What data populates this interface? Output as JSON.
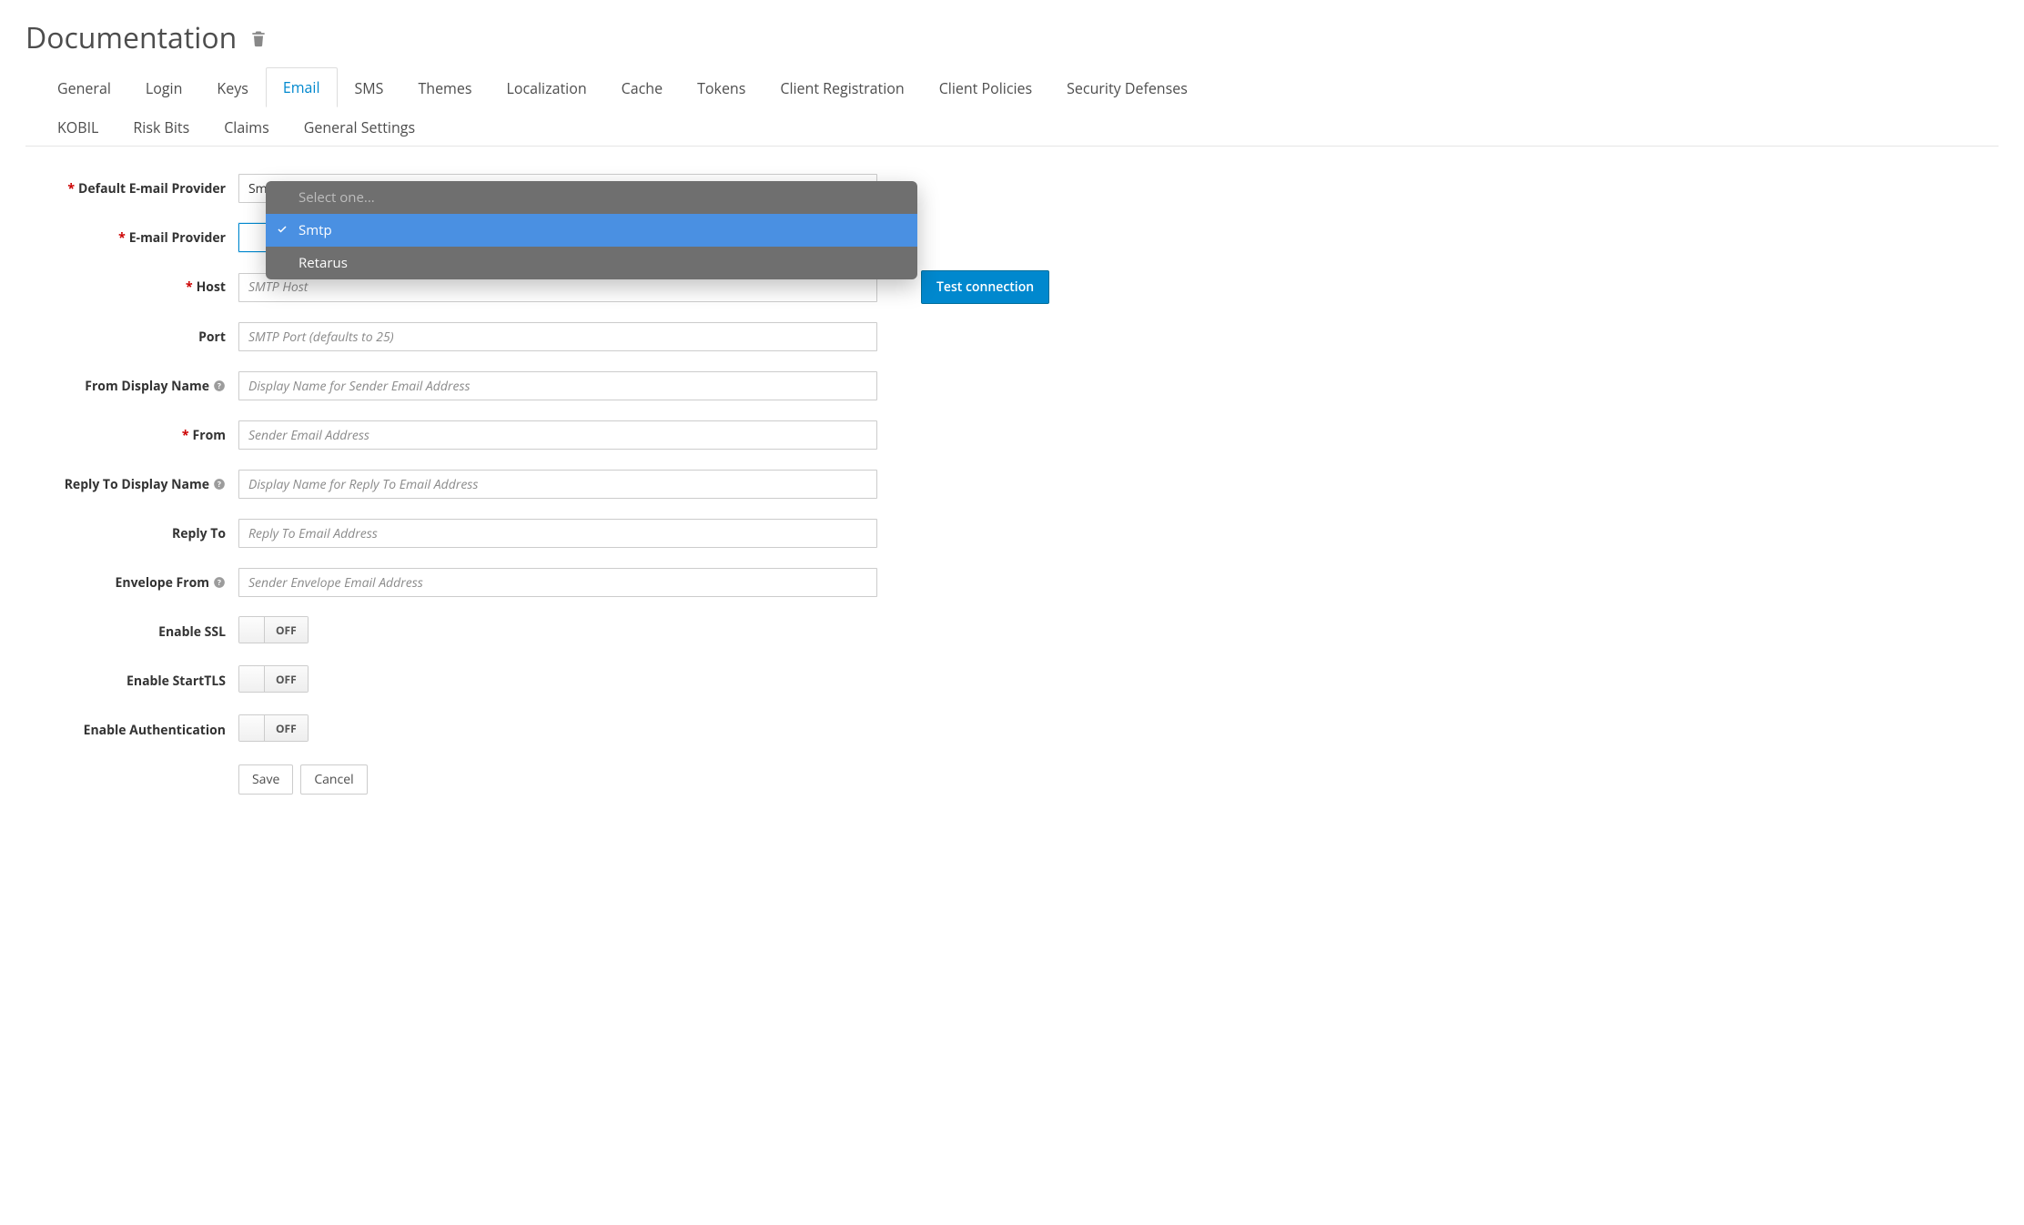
{
  "header": {
    "title": "Documentation"
  },
  "tabs": {
    "row1": [
      "General",
      "Login",
      "Keys",
      "Email",
      "SMS",
      "Themes",
      "Localization",
      "Cache",
      "Tokens",
      "Client Registration",
      "Client Policies",
      "Security Defenses"
    ],
    "row2": [
      "KOBIL",
      "Risk Bits",
      "Claims",
      "General Settings"
    ],
    "active": "Email"
  },
  "dropdown": {
    "placeholder": "Select one...",
    "options": [
      "Smtp",
      "Retarus"
    ],
    "selected": "Smtp"
  },
  "fields": {
    "default_provider": {
      "label": "Default E-mail Provider",
      "value": "Smtp"
    },
    "email_provider": {
      "label": "E-mail Provider",
      "value": ""
    },
    "host": {
      "label": "Host",
      "placeholder": "SMTP Host"
    },
    "port": {
      "label": "Port",
      "placeholder": "SMTP Port (defaults to 25)"
    },
    "from_display": {
      "label": "From Display Name",
      "placeholder": "Display Name for Sender Email Address"
    },
    "from": {
      "label": "From",
      "placeholder": "Sender Email Address"
    },
    "reply_display": {
      "label": "Reply To Display Name",
      "placeholder": "Display Name for Reply To Email Address"
    },
    "reply_to": {
      "label": "Reply To",
      "placeholder": "Reply To Email Address"
    },
    "envelope_from": {
      "label": "Envelope From",
      "placeholder": "Sender Envelope Email Address"
    },
    "enable_ssl": {
      "label": "Enable SSL",
      "value": "OFF"
    },
    "enable_starttls": {
      "label": "Enable StartTLS",
      "value": "OFF"
    },
    "enable_auth": {
      "label": "Enable Authentication",
      "value": "OFF"
    }
  },
  "buttons": {
    "test": "Test connection",
    "save": "Save",
    "cancel": "Cancel"
  }
}
